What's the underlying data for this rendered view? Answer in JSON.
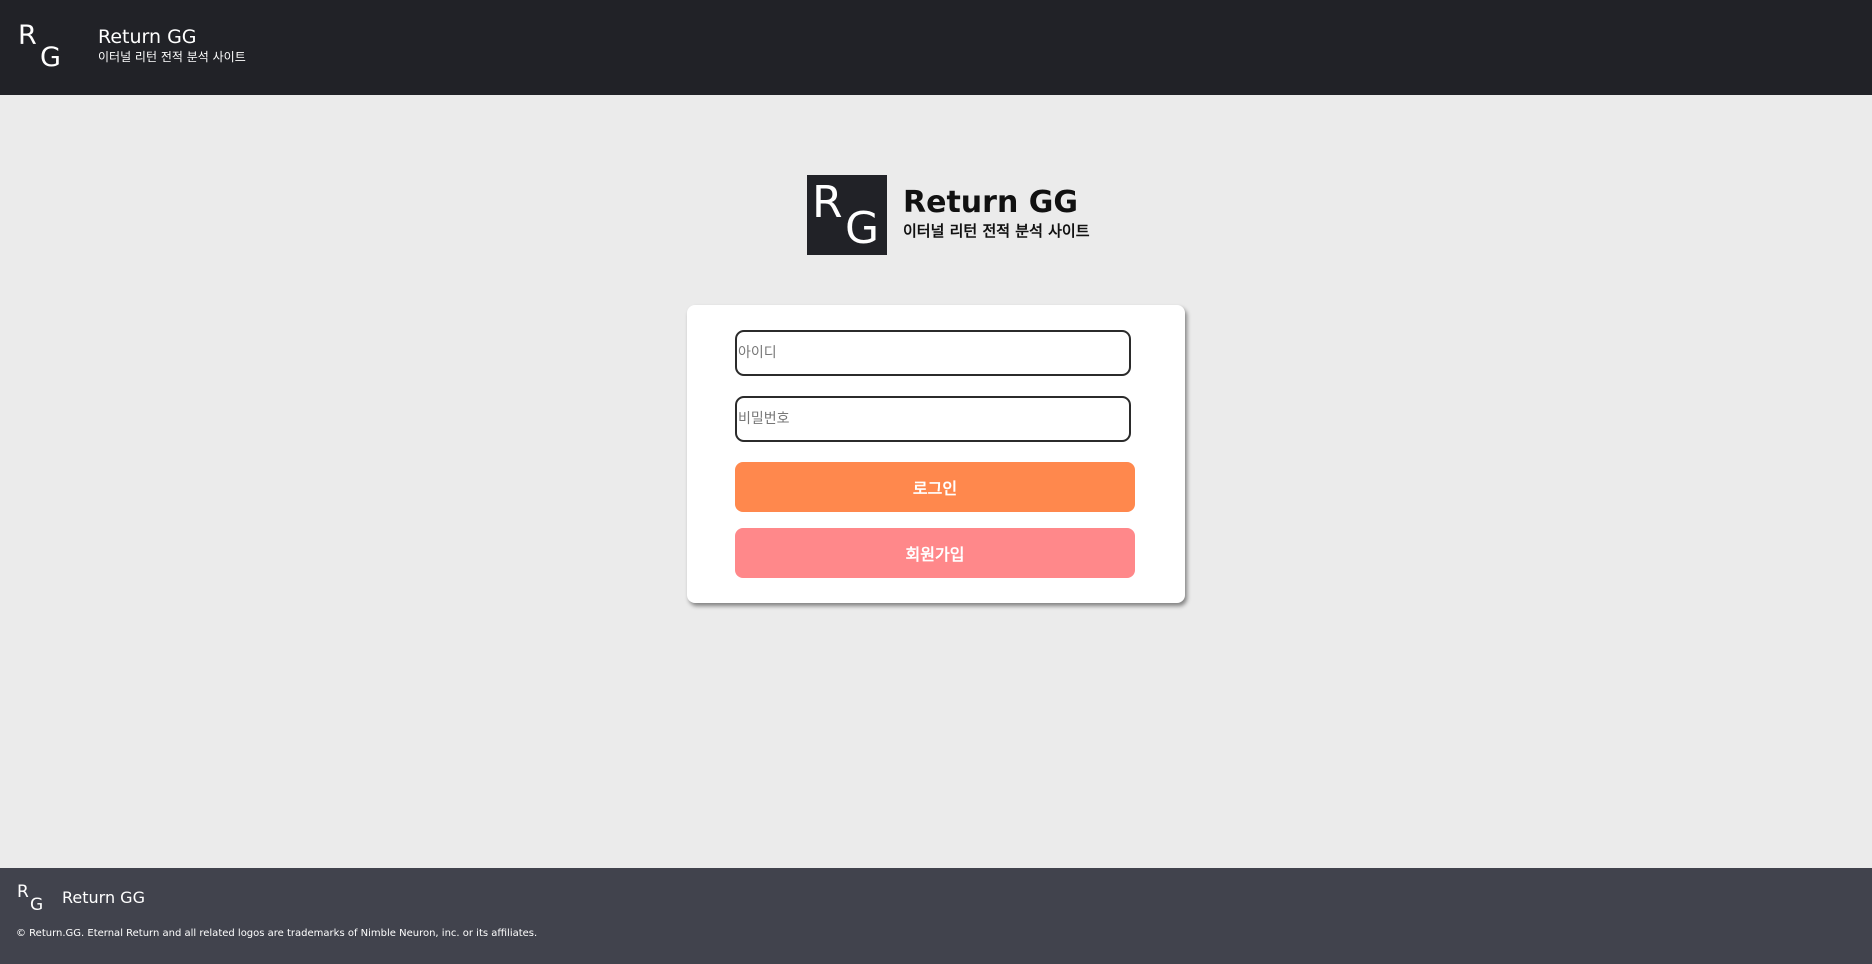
{
  "header": {
    "logo": {
      "r": "R",
      "g": "G"
    },
    "title": "Return GG",
    "subtitle": "이터널 리턴 전적 분석 사이트"
  },
  "hero": {
    "logo": {
      "r": "R",
      "g": "G"
    },
    "title": "Return GG",
    "subtitle": "이터널 리턴 전적 분석 사이트"
  },
  "login_form": {
    "id_placeholder": "아이디",
    "id_value": "",
    "password_placeholder": "비밀번호",
    "password_value": "",
    "login_label": "로그인",
    "signup_label": "회원가입"
  },
  "footer": {
    "logo": {
      "r": "R",
      "g": "G"
    },
    "title": "Return GG",
    "copyright": "© Return.GG. Eternal Return and all related logos are trademarks of Nimble Neuron, inc. or its affiliates."
  },
  "colors": {
    "header_bg": "#212227",
    "page_bg": "#ebebeb",
    "footer_bg": "#41434d",
    "login_button": "#ff884d",
    "signup_button": "#ff888a"
  }
}
